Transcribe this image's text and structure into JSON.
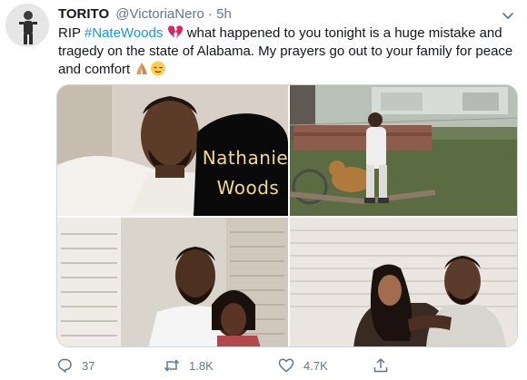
{
  "tweet": {
    "display_name": "TORITO",
    "handle": "@VictoriaNero",
    "separator": "·",
    "time": "5h",
    "text_before": "RIP ",
    "hashtag": "#NateWoods",
    "text_after": " what happened to you tonight is a huge mistake and tragedy on the state of Alabama. My prayers go out to your family for peace and comfort ",
    "emojis": [
      "broken-heart",
      "folded-hands",
      "relieved-face"
    ],
    "photo_overlay_text": [
      "Nathaniel",
      "Woods"
    ],
    "colors": {
      "link": "#1b95e0",
      "text": "#14171a",
      "muted": "#657786",
      "border": "#ccd6dd",
      "broken_heart": "#e0245e"
    }
  },
  "actions": {
    "reply_count": "37",
    "retweet_count": "1.8K",
    "like_count": "4.7K",
    "icons": [
      "reply-icon",
      "retweet-icon",
      "like-icon",
      "share-icon"
    ]
  }
}
